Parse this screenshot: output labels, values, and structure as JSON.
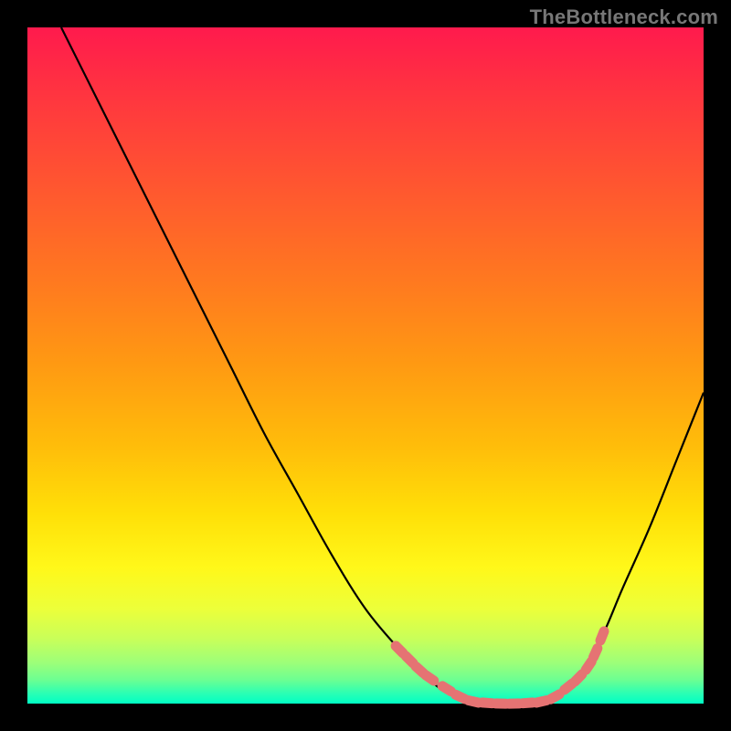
{
  "watermark": {
    "text": "TheBottleneck.com"
  },
  "palette": {
    "black": "#000000",
    "curve": "#000000",
    "marker_fill": "#e57373",
    "marker_stroke": "#b85a5a"
  },
  "gradient": {
    "stops": [
      {
        "offset": 0.0,
        "color": "#ff1a4d"
      },
      {
        "offset": 0.12,
        "color": "#ff3a3d"
      },
      {
        "offset": 0.25,
        "color": "#ff5a2e"
      },
      {
        "offset": 0.38,
        "color": "#ff7a1f"
      },
      {
        "offset": 0.5,
        "color": "#ff9a12"
      },
      {
        "offset": 0.62,
        "color": "#ffbd0a"
      },
      {
        "offset": 0.72,
        "color": "#ffe008"
      },
      {
        "offset": 0.8,
        "color": "#fff81a"
      },
      {
        "offset": 0.86,
        "color": "#ecff3a"
      },
      {
        "offset": 0.905,
        "color": "#c8ff5a"
      },
      {
        "offset": 0.94,
        "color": "#9cff79"
      },
      {
        "offset": 0.965,
        "color": "#6cff92"
      },
      {
        "offset": 0.985,
        "color": "#2affb4"
      },
      {
        "offset": 1.0,
        "color": "#00ffc4"
      }
    ]
  },
  "chart_data": {
    "type": "line",
    "title": "",
    "xlabel": "",
    "ylabel": "",
    "xlim": [
      0,
      100
    ],
    "ylim": [
      0,
      100
    ],
    "series": [
      {
        "name": "bottleneck-curve",
        "x": [
          5,
          10,
          15,
          20,
          25,
          30,
          35,
          40,
          45,
          50,
          55,
          57,
          60,
          63,
          66,
          70,
          73,
          75,
          78,
          80,
          82,
          85,
          88,
          92,
          96,
          100
        ],
        "y": [
          100,
          90,
          80,
          70,
          60,
          50,
          40,
          31,
          22,
          14,
          8,
          6,
          3,
          1.2,
          0.4,
          0,
          0,
          0.2,
          1.0,
          2.5,
          5,
          10,
          17,
          26,
          36,
          46
        ]
      },
      {
        "name": "optimal-markers",
        "x": [
          55,
          56.5,
          58,
          59.5,
          62,
          64,
          66,
          68,
          70,
          72,
          74,
          76,
          78,
          80,
          81.5,
          83,
          84,
          85
        ],
        "y": [
          8,
          6.5,
          5,
          3.8,
          2.2,
          1.0,
          0.3,
          0.1,
          0,
          0,
          0.1,
          0.3,
          1.0,
          2.5,
          3.8,
          5.6,
          7.5,
          10
        ]
      }
    ]
  }
}
